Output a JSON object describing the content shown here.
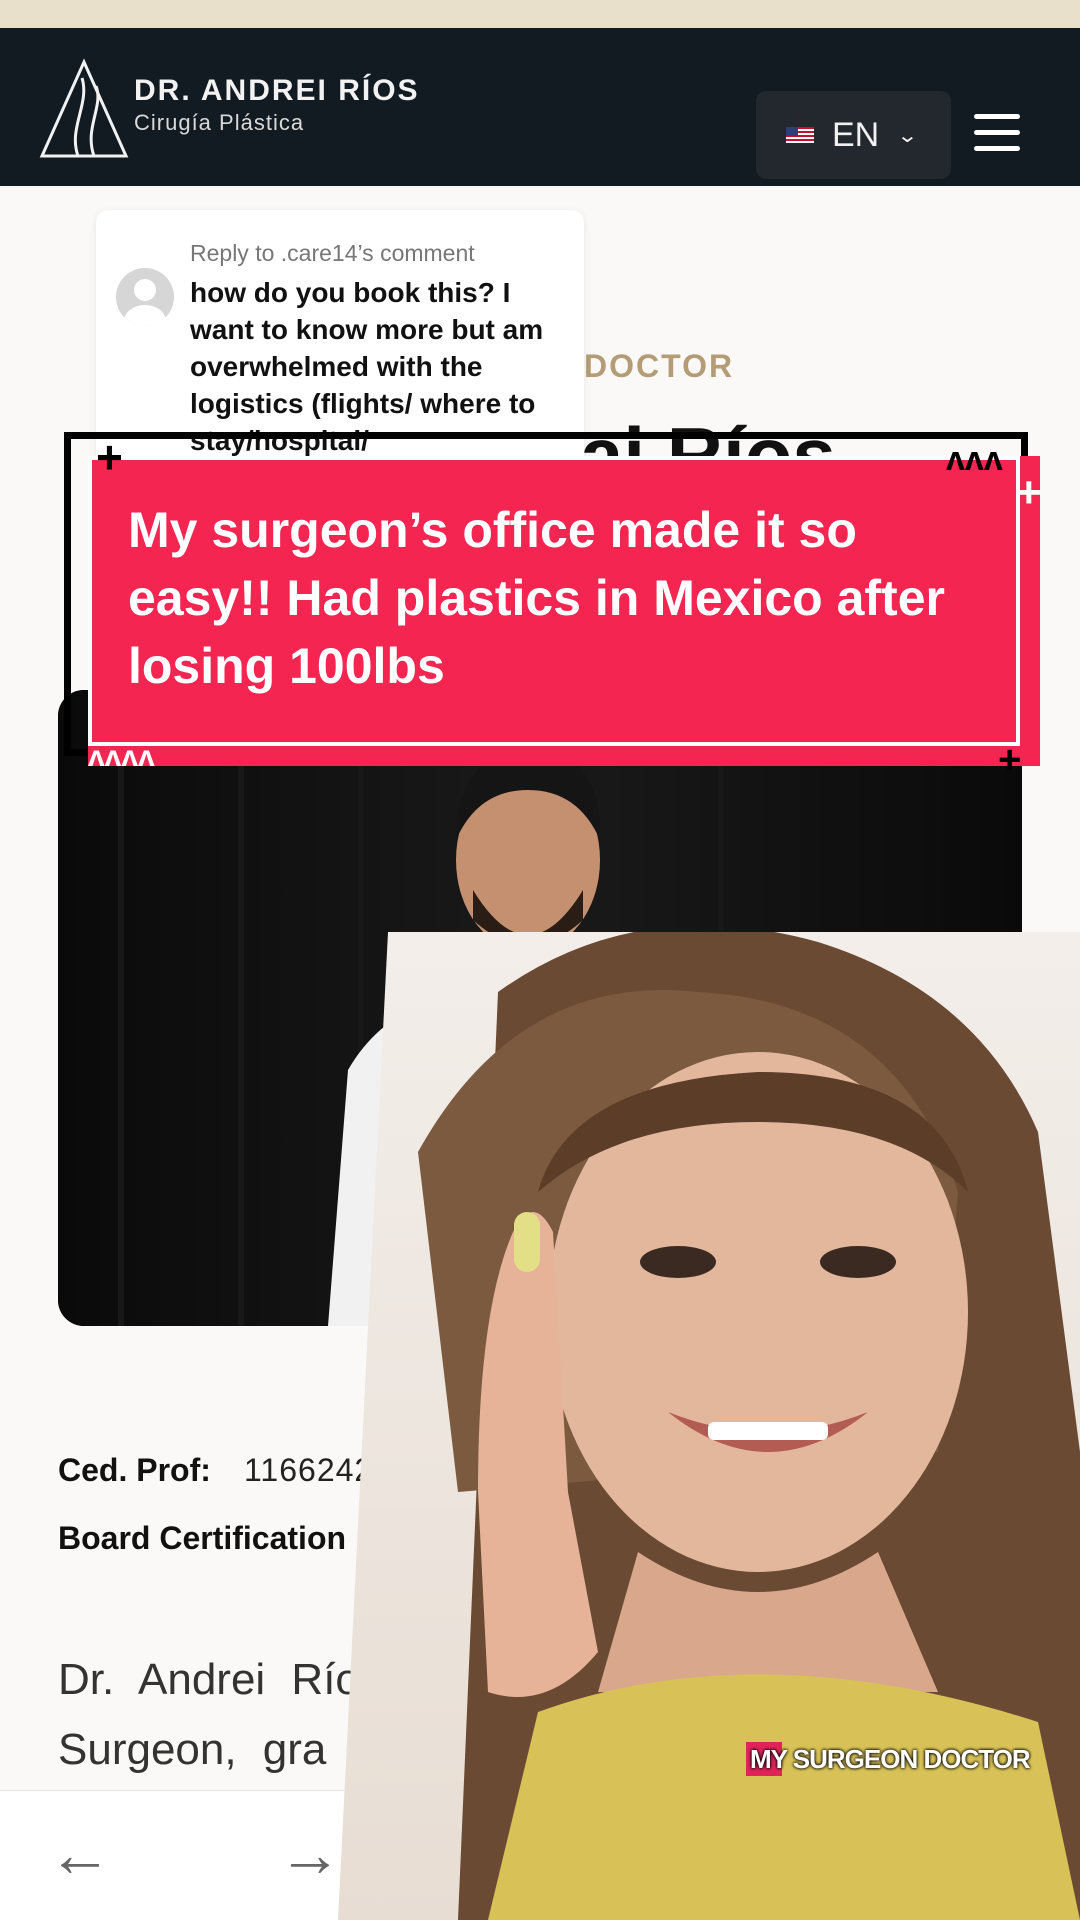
{
  "header": {
    "logo_title": "DR. ANDREI RÍOS",
    "logo_subtitle": "Cirugía Plástica",
    "language": "EN"
  },
  "comment": {
    "reply_to": "Reply to .care14’s comment",
    "text": "how do you book this? I want to know more but am overwhelmed with the logistics (flights/ where to stay/hospital/"
  },
  "page": {
    "kicker": "DOCTOR",
    "title_fragment": "ai Ríos"
  },
  "banner": {
    "text": "My surgeon’s office made it so easy!! Had plastics in Mexico after losing 100lbs"
  },
  "info": {
    "ced_label": "Ced. Prof:",
    "ced_value": "1166242",
    "board_label": "Board Certification"
  },
  "paragraph": {
    "line1": "Dr. Andrei Río",
    "line2": "Surgeon, gra"
  },
  "caption": "MY SURGEON DOCTOR",
  "colors": {
    "header_bg": "#121a22",
    "banner_bg": "#f42551",
    "kicker": "#b49c76"
  }
}
